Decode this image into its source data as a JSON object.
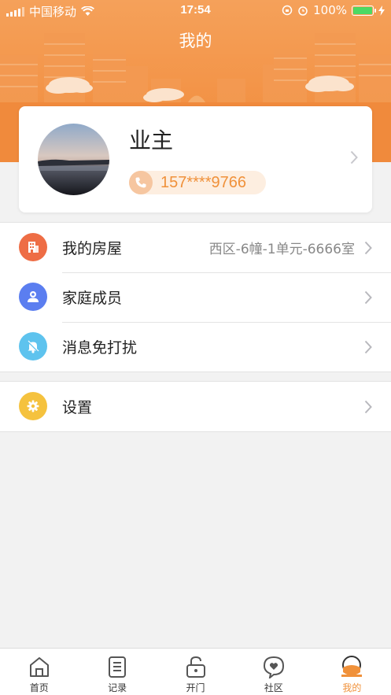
{
  "status_bar": {
    "carrier": "中国移动",
    "time": "17:54",
    "battery_percent": "100%"
  },
  "header": {
    "title": "我的",
    "background_color": "#f29a4f"
  },
  "profile": {
    "name": "业主",
    "phone": "157****9766"
  },
  "menu_group_1": [
    {
      "label": "我的房屋",
      "value": "西区-6幢-1单元-6666室",
      "icon": "building-icon",
      "icon_color": "#ee6d45"
    },
    {
      "label": "家庭成员",
      "value": "",
      "icon": "family-member-icon",
      "icon_color": "#5b7ef0"
    },
    {
      "label": "消息免打扰",
      "value": "",
      "icon": "bell-mute-icon",
      "icon_color": "#5ec3ee"
    }
  ],
  "menu_group_2": [
    {
      "label": "设置",
      "value": "",
      "icon": "gear-icon",
      "icon_color": "#f5c23e"
    }
  ],
  "tabbar": [
    {
      "label": "首页",
      "icon": "home-icon",
      "active": false
    },
    {
      "label": "记录",
      "icon": "record-icon",
      "active": false
    },
    {
      "label": "开门",
      "icon": "unlock-icon",
      "active": false
    },
    {
      "label": "社区",
      "icon": "community-icon",
      "active": false
    },
    {
      "label": "我的",
      "icon": "profile-icon",
      "active": true
    }
  ],
  "colors": {
    "accent": "#f0913a",
    "background": "#f2f2f2"
  }
}
